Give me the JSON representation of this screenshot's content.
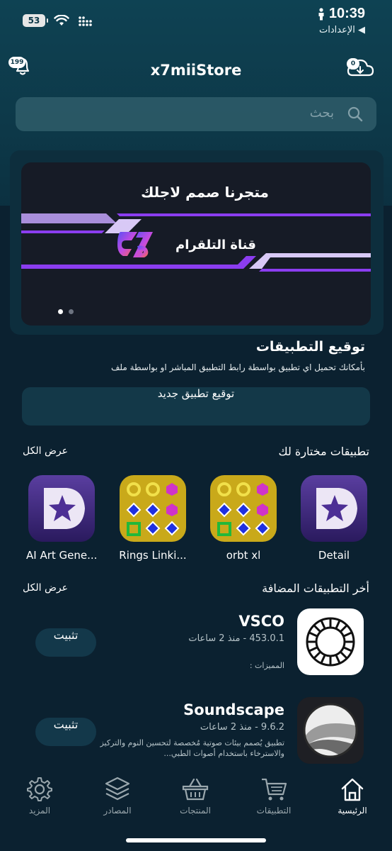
{
  "status_bar": {
    "battery": "53",
    "time": "10:39",
    "back_label": "◀ الإعدادات"
  },
  "header": {
    "title": "x7miiStore",
    "notifications_badge": "199",
    "cloud_badge": "0"
  },
  "search": {
    "placeholder": "بحث"
  },
  "banner": {
    "headline": "متجرنا صمم لاجلك",
    "channel": "قناة التلقرام",
    "slides_total": 2,
    "slide_active": 1
  },
  "signing": {
    "title": "توقيع التطبيقات",
    "description": "بأمكانك تحميل اي تطبيق بواسطة رابط التطبيق المباشر او بواسطة ملف",
    "button_label": "توقيع تطبيق جديد"
  },
  "featured": {
    "title": "تطبيقات مختارة لك",
    "see_all": "عرض الكل",
    "apps": [
      {
        "name": "Detail",
        "icon": "star-play-icon"
      },
      {
        "name": "orbt xl",
        "icon": "rings-pattern-icon"
      },
      {
        "name": "Rings Linki...",
        "icon": "rings-pattern-icon"
      },
      {
        "name": "AI Art Gene...",
        "icon": "star-play-icon"
      }
    ]
  },
  "latest": {
    "title": "أخر التطبيقات المضافة",
    "see_all": "عرض الكل",
    "apps": [
      {
        "name": "VSCO",
        "meta": "453.0.1 - منذ 2 ساعات",
        "desc": "المميزات :",
        "install": "تثبيت",
        "icon": "vsco-icon"
      },
      {
        "name": "Soundscape",
        "meta": "9.6.2 - منذ 2 ساعات",
        "desc": "تطبيق يُصمم بيئات صوتية مُخصصة لتحسين النوم والتركيز والاسترخاء باستخدام أصوات الطبي...",
        "install": "تثبيت",
        "icon": "soundscape-icon"
      }
    ]
  },
  "tabbar": {
    "items": [
      {
        "label": "الرئيسية",
        "icon": "home-icon",
        "active": true
      },
      {
        "label": "التطبيقات",
        "icon": "cart-icon"
      },
      {
        "label": "المنتجات",
        "icon": "basket-icon"
      },
      {
        "label": "المصادر",
        "icon": "layers-icon"
      },
      {
        "label": "المزيد",
        "icon": "gear-icon"
      }
    ]
  },
  "colors": {
    "background": "#0b2433",
    "header_bg": "#0e4253",
    "accent_purple": "#8b3df0",
    "banner_bg": "#161b26"
  }
}
